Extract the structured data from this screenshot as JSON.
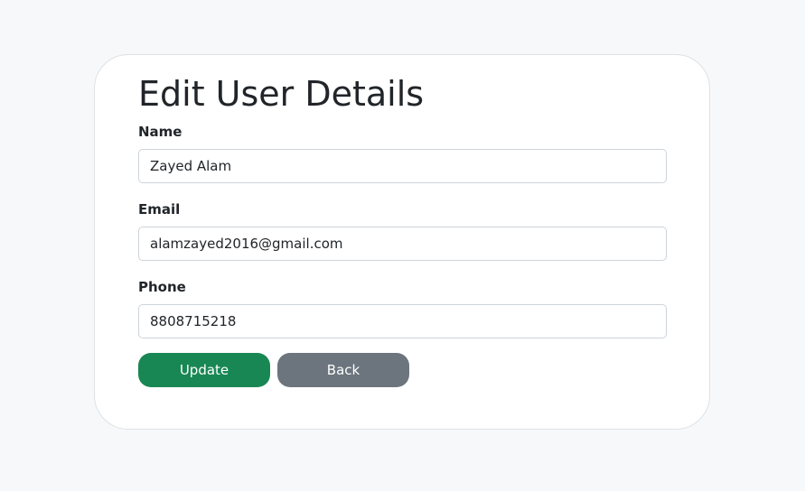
{
  "form": {
    "title": "Edit User Details",
    "fields": [
      {
        "label": "Name",
        "value": "Zayed Alam"
      },
      {
        "label": "Email",
        "value": "alamzayed2016@gmail.com"
      },
      {
        "label": "Phone",
        "value": "8808715218"
      }
    ],
    "update_label": "Update",
    "back_label": "Back"
  },
  "colors": {
    "update_button": "#198754",
    "back_button": "#6c757d",
    "page_background": "#f7f8fa"
  }
}
